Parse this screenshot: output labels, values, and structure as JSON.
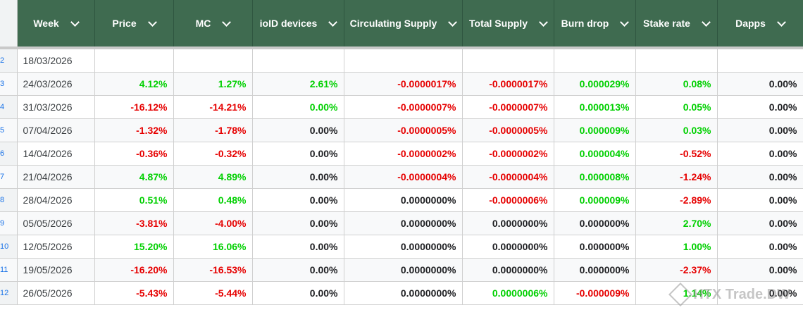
{
  "colors": {
    "header_bg": "#3f6b50",
    "positive": "#00d000",
    "negative": "#e60000",
    "neutral": "#202124"
  },
  "headers": [
    "Week",
    "Price",
    "MC",
    "ioID devices",
    "Circulating Supply",
    "Total Supply",
    "Burn drop",
    "Stake rate",
    "Dapps"
  ],
  "rows": [
    {
      "idx": "2",
      "week": "18/03/2026",
      "cells": [
        {
          "v": "",
          "c": "black"
        },
        {
          "v": "",
          "c": "black"
        },
        {
          "v": "",
          "c": "black"
        },
        {
          "v": "",
          "c": "black"
        },
        {
          "v": "",
          "c": "black"
        },
        {
          "v": "",
          "c": "black"
        },
        {
          "v": "",
          "c": "black"
        },
        {
          "v": "",
          "c": "black"
        }
      ]
    },
    {
      "idx": "3",
      "week": "24/03/2026",
      "cells": [
        {
          "v": "4.12%",
          "c": "green"
        },
        {
          "v": "1.27%",
          "c": "green"
        },
        {
          "v": "2.61%",
          "c": "green"
        },
        {
          "v": "-0.0000017%",
          "c": "red"
        },
        {
          "v": "-0.0000017%",
          "c": "red"
        },
        {
          "v": "0.000029%",
          "c": "green"
        },
        {
          "v": "0.08%",
          "c": "green"
        },
        {
          "v": "0.00%",
          "c": "black"
        }
      ]
    },
    {
      "idx": "4",
      "week": "31/03/2026",
      "cells": [
        {
          "v": "-16.12%",
          "c": "red"
        },
        {
          "v": "-14.21%",
          "c": "red"
        },
        {
          "v": "0.00%",
          "c": "green"
        },
        {
          "v": "-0.0000007%",
          "c": "red"
        },
        {
          "v": "-0.0000007%",
          "c": "red"
        },
        {
          "v": "0.000013%",
          "c": "green"
        },
        {
          "v": "0.05%",
          "c": "green"
        },
        {
          "v": "0.00%",
          "c": "black"
        }
      ]
    },
    {
      "idx": "5",
      "week": "07/04/2026",
      "cells": [
        {
          "v": "-1.32%",
          "c": "red"
        },
        {
          "v": "-1.78%",
          "c": "red"
        },
        {
          "v": "0.00%",
          "c": "black"
        },
        {
          "v": "-0.0000005%",
          "c": "red"
        },
        {
          "v": "-0.0000005%",
          "c": "red"
        },
        {
          "v": "0.000009%",
          "c": "green"
        },
        {
          "v": "0.03%",
          "c": "green"
        },
        {
          "v": "0.00%",
          "c": "black"
        }
      ]
    },
    {
      "idx": "6",
      "week": "14/04/2026",
      "cells": [
        {
          "v": "-0.36%",
          "c": "red"
        },
        {
          "v": "-0.32%",
          "c": "red"
        },
        {
          "v": "0.00%",
          "c": "black"
        },
        {
          "v": "-0.0000002%",
          "c": "red"
        },
        {
          "v": "-0.0000002%",
          "c": "red"
        },
        {
          "v": "0.000004%",
          "c": "green"
        },
        {
          "v": "-0.52%",
          "c": "red"
        },
        {
          "v": "0.00%",
          "c": "black"
        }
      ]
    },
    {
      "idx": "7",
      "week": "21/04/2026",
      "cells": [
        {
          "v": "4.87%",
          "c": "green"
        },
        {
          "v": "4.89%",
          "c": "green"
        },
        {
          "v": "0.00%",
          "c": "black"
        },
        {
          "v": "-0.0000004%",
          "c": "red"
        },
        {
          "v": "-0.0000004%",
          "c": "red"
        },
        {
          "v": "0.000008%",
          "c": "green"
        },
        {
          "v": "-1.24%",
          "c": "red"
        },
        {
          "v": "0.00%",
          "c": "black"
        }
      ]
    },
    {
      "idx": "8",
      "week": "28/04/2026",
      "cells": [
        {
          "v": "0.51%",
          "c": "green"
        },
        {
          "v": "0.48%",
          "c": "green"
        },
        {
          "v": "0.00%",
          "c": "black"
        },
        {
          "v": "0.0000000%",
          "c": "black"
        },
        {
          "v": "-0.0000006%",
          "c": "red"
        },
        {
          "v": "0.000009%",
          "c": "green"
        },
        {
          "v": "-2.89%",
          "c": "red"
        },
        {
          "v": "0.00%",
          "c": "black"
        }
      ]
    },
    {
      "idx": "9",
      "week": "05/05/2026",
      "cells": [
        {
          "v": "-3.81%",
          "c": "red"
        },
        {
          "v": "-4.00%",
          "c": "red"
        },
        {
          "v": "0.00%",
          "c": "black"
        },
        {
          "v": "0.0000000%",
          "c": "black"
        },
        {
          "v": "0.0000000%",
          "c": "black"
        },
        {
          "v": "0.000000%",
          "c": "black"
        },
        {
          "v": "2.70%",
          "c": "green"
        },
        {
          "v": "0.00%",
          "c": "black"
        }
      ]
    },
    {
      "idx": "10",
      "week": "12/05/2026",
      "cells": [
        {
          "v": "15.20%",
          "c": "green"
        },
        {
          "v": "16.06%",
          "c": "green"
        },
        {
          "v": "0.00%",
          "c": "black"
        },
        {
          "v": "0.0000000%",
          "c": "black"
        },
        {
          "v": "0.0000000%",
          "c": "black"
        },
        {
          "v": "0.000000%",
          "c": "black"
        },
        {
          "v": "1.00%",
          "c": "green"
        },
        {
          "v": "0.00%",
          "c": "black"
        }
      ]
    },
    {
      "idx": "11",
      "week": "19/05/2026",
      "cells": [
        {
          "v": "-16.20%",
          "c": "red"
        },
        {
          "v": "-16.53%",
          "c": "red"
        },
        {
          "v": "0.00%",
          "c": "black"
        },
        {
          "v": "0.0000000%",
          "c": "black"
        },
        {
          "v": "0.0000000%",
          "c": "black"
        },
        {
          "v": "0.000000%",
          "c": "black"
        },
        {
          "v": "-2.37%",
          "c": "red"
        },
        {
          "v": "0.00%",
          "c": "black"
        }
      ]
    },
    {
      "idx": "12",
      "week": "26/05/2026",
      "cells": [
        {
          "v": "-5.43%",
          "c": "red"
        },
        {
          "v": "-5.44%",
          "c": "red"
        },
        {
          "v": "0.00%",
          "c": "black"
        },
        {
          "v": "0.0000000%",
          "c": "black"
        },
        {
          "v": "0.0000006%",
          "c": "green"
        },
        {
          "v": "-0.000009%",
          "c": "red"
        },
        {
          "v": "1.14%",
          "c": "green"
        },
        {
          "v": "0.00%",
          "c": "black"
        }
      ]
    }
  ],
  "watermark": "HTX Trade.DW"
}
